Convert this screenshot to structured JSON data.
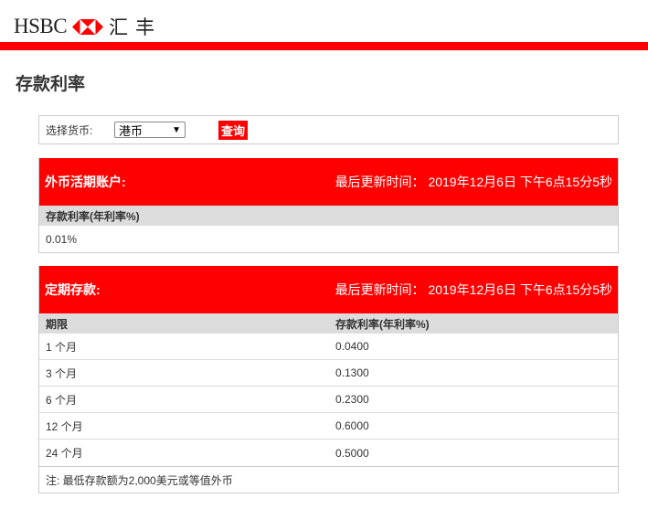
{
  "header": {
    "logo_text": "HSBC",
    "logo_cn": "汇丰"
  },
  "page_title": "存款利率",
  "filter": {
    "label": "选择货币:",
    "currency": "港币",
    "query_button": "查询"
  },
  "savings": {
    "title": "外币活期账户:",
    "updated": "最后更新时间： 2019年12月6日 下午6点15分5秒",
    "column": "存款利率(年利率%)",
    "rate": "0.01%"
  },
  "fixed": {
    "title": "定期存款:",
    "updated": "最后更新时间： 2019年12月6日 下午6点15分5秒",
    "columns": [
      "期限",
      "存款利率(年利率%)"
    ],
    "rows": [
      [
        "1 个月",
        "0.0400"
      ],
      [
        "3 个月",
        "0.1300"
      ],
      [
        "6 个月",
        "0.2300"
      ],
      [
        "12 个月",
        "0.6000"
      ],
      [
        "24 个月",
        "0.5000"
      ]
    ],
    "note": "注: 最低存款额为2,000美元或等值外币"
  },
  "colors": {
    "brand_red": "#ff0000"
  }
}
